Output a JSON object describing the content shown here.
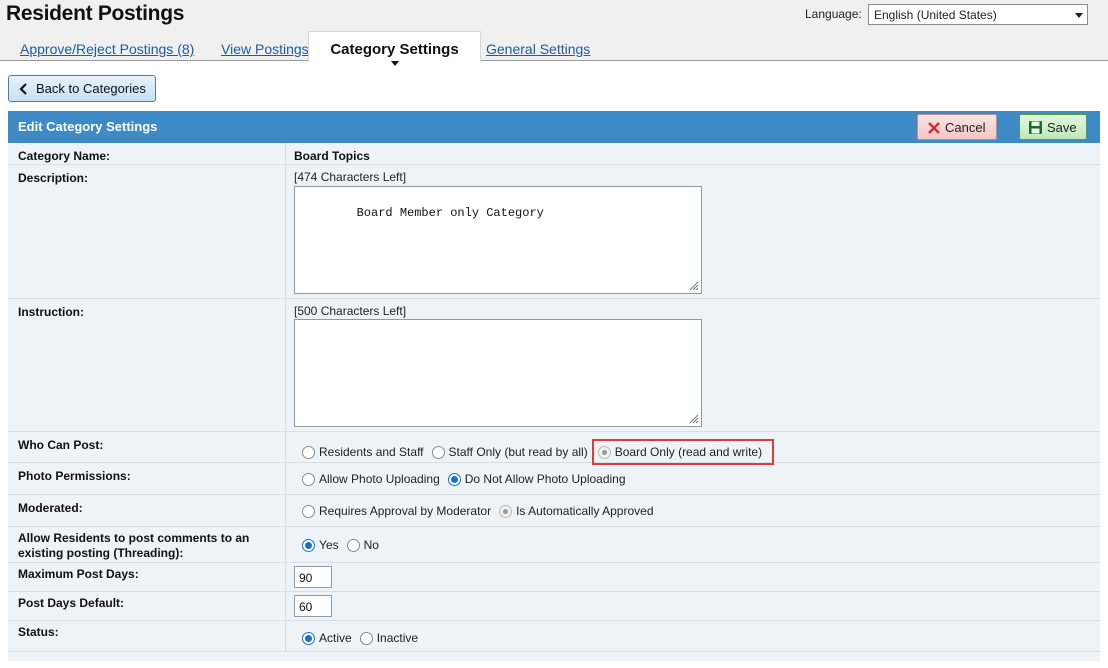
{
  "header": {
    "title": "Resident Postings",
    "language_label": "Language:",
    "language_value": "English (United States)"
  },
  "tabs": [
    {
      "label": "Approve/Reject Postings (8)",
      "active": false
    },
    {
      "label": "View Postings",
      "active": false
    },
    {
      "label": "Category Settings",
      "active": true
    },
    {
      "label": "General Settings",
      "active": false
    }
  ],
  "back_button": {
    "label": "Back to Categories",
    "icon": "chevron-left-icon"
  },
  "panel": {
    "title": "Edit Category Settings",
    "cancel_label": "Cancel",
    "save_label": "Save",
    "colors": {
      "header": "#3d8ac7",
      "body": "#eef3f8",
      "cancel": "#f3c6c6",
      "save": "#bfe8b9",
      "highlight": "#e03a3a"
    }
  },
  "form": {
    "category_name": {
      "label": "Category Name:",
      "value": "Board Topics"
    },
    "description": {
      "label": "Description:",
      "chars_left": "[474 Characters Left]",
      "value": "Board Member only Category"
    },
    "instruction": {
      "label": "Instruction:",
      "chars_left": "[500 Characters Left]",
      "value": ""
    },
    "who_can_post": {
      "label": "Who Can Post:",
      "options": [
        "Residents and Staff",
        "Staff Only (but read by all)",
        "Board Only (read and write)"
      ],
      "selected": "Board Only (read and write)"
    },
    "photo_permissions": {
      "label": "Photo Permissions:",
      "options": [
        "Allow Photo Uploading",
        "Do Not Allow Photo Uploading"
      ],
      "selected": "Do Not Allow Photo Uploading"
    },
    "moderated": {
      "label": "Moderated:",
      "options": [
        "Requires Approval by Moderator",
        "Is Automatically Approved"
      ],
      "selected": "Is Automatically Approved"
    },
    "threading": {
      "label": "Allow Residents to post comments to an existing posting (Threading):",
      "options": [
        "Yes",
        "No"
      ],
      "selected": "Yes"
    },
    "max_post_days": {
      "label": "Maximum Post Days:",
      "value": "90"
    },
    "post_days_default": {
      "label": "Post Days Default:",
      "value": "60"
    },
    "status": {
      "label": "Status:",
      "options": [
        "Active",
        "Inactive"
      ],
      "selected": "Active"
    }
  }
}
